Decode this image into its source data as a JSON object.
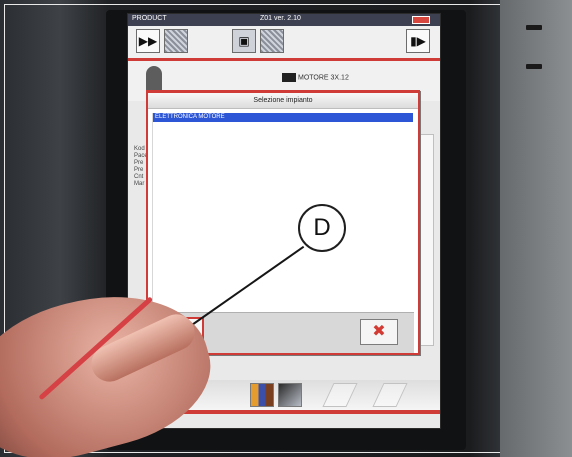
{
  "screen": {
    "titlebar": {
      "left": "PRODUCT",
      "center": "Z01 ver. 2.10"
    },
    "dialog": {
      "title": "Selezione impianto",
      "list_items": [
        "ELETTRONICA MOTORE"
      ],
      "ok_icon": "check-icon",
      "cancel_icon": "cross-icon"
    },
    "motor_label": "MOTORE 3X.12",
    "background_labels": [
      "Kod",
      "Pace",
      "Pre",
      "Pre",
      "Cnt",
      "Mar"
    ]
  },
  "annotation": {
    "callout_letter": "D"
  },
  "colors": {
    "accent_red": "#cf3c37",
    "selection_blue": "#2c56d6",
    "titlebar_bg": "#3d4050"
  }
}
